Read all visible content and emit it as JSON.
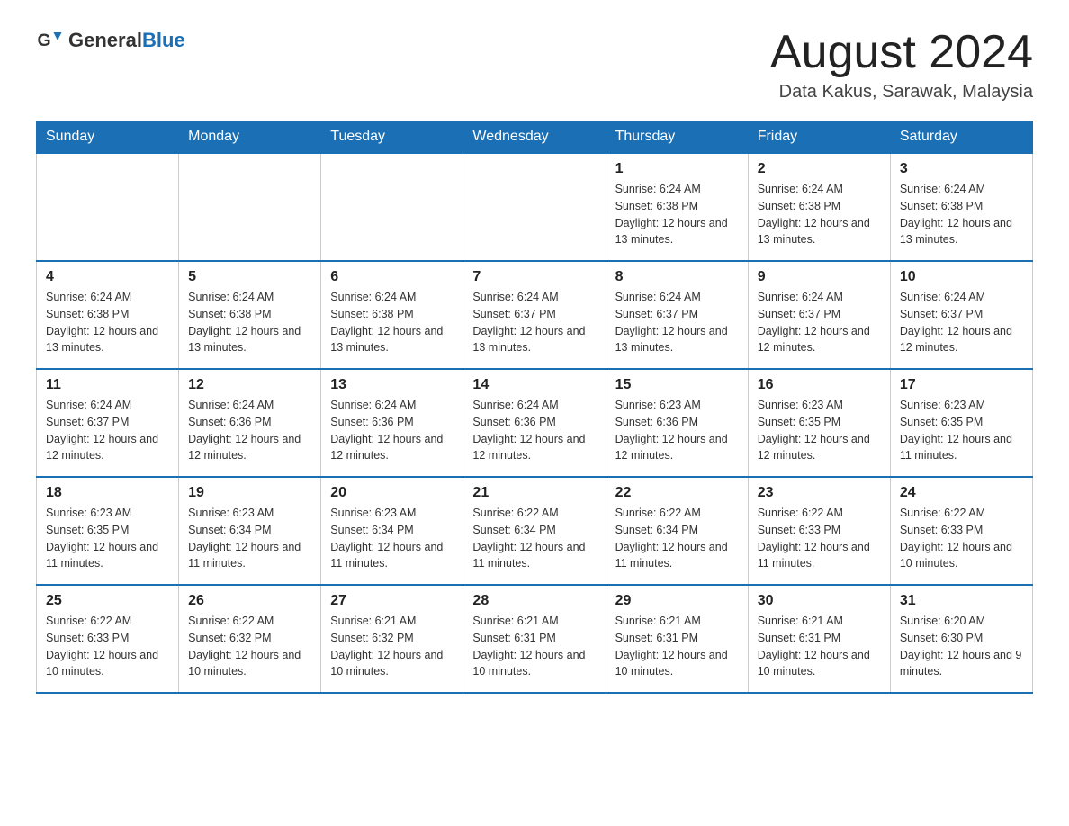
{
  "header": {
    "logo_general": "General",
    "logo_blue": "Blue",
    "month_title": "August 2024",
    "location": "Data Kakus, Sarawak, Malaysia"
  },
  "days_of_week": [
    "Sunday",
    "Monday",
    "Tuesday",
    "Wednesday",
    "Thursday",
    "Friday",
    "Saturday"
  ],
  "weeks": [
    {
      "days": [
        {
          "number": "",
          "info": ""
        },
        {
          "number": "",
          "info": ""
        },
        {
          "number": "",
          "info": ""
        },
        {
          "number": "",
          "info": ""
        },
        {
          "number": "1",
          "info": "Sunrise: 6:24 AM\nSunset: 6:38 PM\nDaylight: 12 hours and 13 minutes."
        },
        {
          "number": "2",
          "info": "Sunrise: 6:24 AM\nSunset: 6:38 PM\nDaylight: 12 hours and 13 minutes."
        },
        {
          "number": "3",
          "info": "Sunrise: 6:24 AM\nSunset: 6:38 PM\nDaylight: 12 hours and 13 minutes."
        }
      ]
    },
    {
      "days": [
        {
          "number": "4",
          "info": "Sunrise: 6:24 AM\nSunset: 6:38 PM\nDaylight: 12 hours and 13 minutes."
        },
        {
          "number": "5",
          "info": "Sunrise: 6:24 AM\nSunset: 6:38 PM\nDaylight: 12 hours and 13 minutes."
        },
        {
          "number": "6",
          "info": "Sunrise: 6:24 AM\nSunset: 6:38 PM\nDaylight: 12 hours and 13 minutes."
        },
        {
          "number": "7",
          "info": "Sunrise: 6:24 AM\nSunset: 6:37 PM\nDaylight: 12 hours and 13 minutes."
        },
        {
          "number": "8",
          "info": "Sunrise: 6:24 AM\nSunset: 6:37 PM\nDaylight: 12 hours and 13 minutes."
        },
        {
          "number": "9",
          "info": "Sunrise: 6:24 AM\nSunset: 6:37 PM\nDaylight: 12 hours and 12 minutes."
        },
        {
          "number": "10",
          "info": "Sunrise: 6:24 AM\nSunset: 6:37 PM\nDaylight: 12 hours and 12 minutes."
        }
      ]
    },
    {
      "days": [
        {
          "number": "11",
          "info": "Sunrise: 6:24 AM\nSunset: 6:37 PM\nDaylight: 12 hours and 12 minutes."
        },
        {
          "number": "12",
          "info": "Sunrise: 6:24 AM\nSunset: 6:36 PM\nDaylight: 12 hours and 12 minutes."
        },
        {
          "number": "13",
          "info": "Sunrise: 6:24 AM\nSunset: 6:36 PM\nDaylight: 12 hours and 12 minutes."
        },
        {
          "number": "14",
          "info": "Sunrise: 6:24 AM\nSunset: 6:36 PM\nDaylight: 12 hours and 12 minutes."
        },
        {
          "number": "15",
          "info": "Sunrise: 6:23 AM\nSunset: 6:36 PM\nDaylight: 12 hours and 12 minutes."
        },
        {
          "number": "16",
          "info": "Sunrise: 6:23 AM\nSunset: 6:35 PM\nDaylight: 12 hours and 12 minutes."
        },
        {
          "number": "17",
          "info": "Sunrise: 6:23 AM\nSunset: 6:35 PM\nDaylight: 12 hours and 11 minutes."
        }
      ]
    },
    {
      "days": [
        {
          "number": "18",
          "info": "Sunrise: 6:23 AM\nSunset: 6:35 PM\nDaylight: 12 hours and 11 minutes."
        },
        {
          "number": "19",
          "info": "Sunrise: 6:23 AM\nSunset: 6:34 PM\nDaylight: 12 hours and 11 minutes."
        },
        {
          "number": "20",
          "info": "Sunrise: 6:23 AM\nSunset: 6:34 PM\nDaylight: 12 hours and 11 minutes."
        },
        {
          "number": "21",
          "info": "Sunrise: 6:22 AM\nSunset: 6:34 PM\nDaylight: 12 hours and 11 minutes."
        },
        {
          "number": "22",
          "info": "Sunrise: 6:22 AM\nSunset: 6:34 PM\nDaylight: 12 hours and 11 minutes."
        },
        {
          "number": "23",
          "info": "Sunrise: 6:22 AM\nSunset: 6:33 PM\nDaylight: 12 hours and 11 minutes."
        },
        {
          "number": "24",
          "info": "Sunrise: 6:22 AM\nSunset: 6:33 PM\nDaylight: 12 hours and 10 minutes."
        }
      ]
    },
    {
      "days": [
        {
          "number": "25",
          "info": "Sunrise: 6:22 AM\nSunset: 6:33 PM\nDaylight: 12 hours and 10 minutes."
        },
        {
          "number": "26",
          "info": "Sunrise: 6:22 AM\nSunset: 6:32 PM\nDaylight: 12 hours and 10 minutes."
        },
        {
          "number": "27",
          "info": "Sunrise: 6:21 AM\nSunset: 6:32 PM\nDaylight: 12 hours and 10 minutes."
        },
        {
          "number": "28",
          "info": "Sunrise: 6:21 AM\nSunset: 6:31 PM\nDaylight: 12 hours and 10 minutes."
        },
        {
          "number": "29",
          "info": "Sunrise: 6:21 AM\nSunset: 6:31 PM\nDaylight: 12 hours and 10 minutes."
        },
        {
          "number": "30",
          "info": "Sunrise: 6:21 AM\nSunset: 6:31 PM\nDaylight: 12 hours and 10 minutes."
        },
        {
          "number": "31",
          "info": "Sunrise: 6:20 AM\nSunset: 6:30 PM\nDaylight: 12 hours and 9 minutes."
        }
      ]
    }
  ]
}
